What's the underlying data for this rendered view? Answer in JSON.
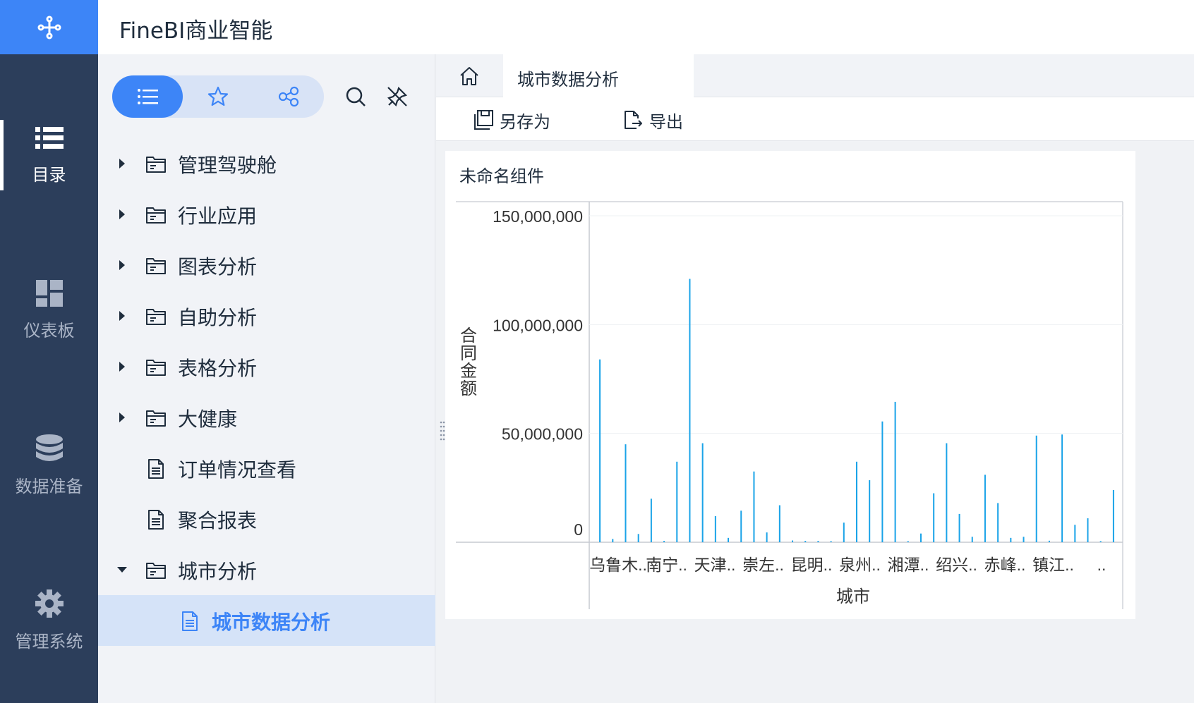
{
  "app": {
    "title": "FineBI商业智能"
  },
  "nav": {
    "logo_icon": "finebi-logo-icon",
    "items": [
      {
        "label": "目录",
        "icon": "list-icon",
        "active": true
      },
      {
        "label": "仪表板",
        "icon": "dashboard-icon",
        "active": false
      },
      {
        "label": "数据准备",
        "icon": "database-icon",
        "active": false
      },
      {
        "label": "管理系统",
        "icon": "gear-icon",
        "active": false
      }
    ]
  },
  "directory": {
    "view_toggle": [
      "list-view-icon",
      "favorites-star-icon",
      "share-icon"
    ],
    "tools": [
      "search-icon",
      "unpin-icon"
    ],
    "items": [
      {
        "label": "管理驾驶舱",
        "type": "folder",
        "expanded": false
      },
      {
        "label": "行业应用",
        "type": "folder",
        "expanded": false
      },
      {
        "label": "图表分析",
        "type": "folder",
        "expanded": false
      },
      {
        "label": "自助分析",
        "type": "folder",
        "expanded": false
      },
      {
        "label": "表格分析",
        "type": "folder",
        "expanded": false
      },
      {
        "label": "大健康",
        "type": "folder",
        "expanded": false
      },
      {
        "label": "订单情况查看",
        "type": "report"
      },
      {
        "label": "聚合报表",
        "type": "report"
      },
      {
        "label": "城市分析",
        "type": "folder",
        "expanded": true
      },
      {
        "label": "城市数据分析",
        "type": "report",
        "selected": true
      }
    ]
  },
  "tabs": {
    "home_icon": "home-icon",
    "active_label": "城市数据分析"
  },
  "toolbar": {
    "save_as_label": "另存为",
    "export_label": "导出"
  },
  "widget": {
    "title": "未命名组件"
  },
  "colors": {
    "accent": "#3d85f7",
    "nav_bg": "#2c3e5b",
    "bar": "#1aa3e8"
  },
  "chart_data": {
    "type": "bar",
    "xlabel": "城市",
    "ylabel": "合同金额",
    "ylim": [
      0,
      150000000
    ],
    "yticks": [
      "0",
      "50,000,000",
      "100,000,000",
      "150,000,000"
    ],
    "tick_labels": [
      "乌鲁木..",
      "南宁..",
      "天津..",
      "崇左..",
      "昆明..",
      "泉州..",
      "湘潭..",
      "绍兴..",
      "赤峰..",
      "镇江..",
      ".."
    ],
    "values": [
      84000000,
      1500000,
      45000000,
      3800000,
      20000000,
      600000,
      37000000,
      121000000,
      45500000,
      12000000,
      2000000,
      14500000,
      32500000,
      4500000,
      17000000,
      800000,
      600000,
      600000,
      500000,
      9000000,
      37000000,
      28500000,
      55500000,
      64500000,
      500000,
      4000000,
      22500000,
      45500000,
      13000000,
      2500000,
      31000000,
      18000000,
      2000000,
      2500000,
      49000000,
      700000,
      49500000,
      8000000,
      11000000,
      500000,
      24000000
    ]
  }
}
